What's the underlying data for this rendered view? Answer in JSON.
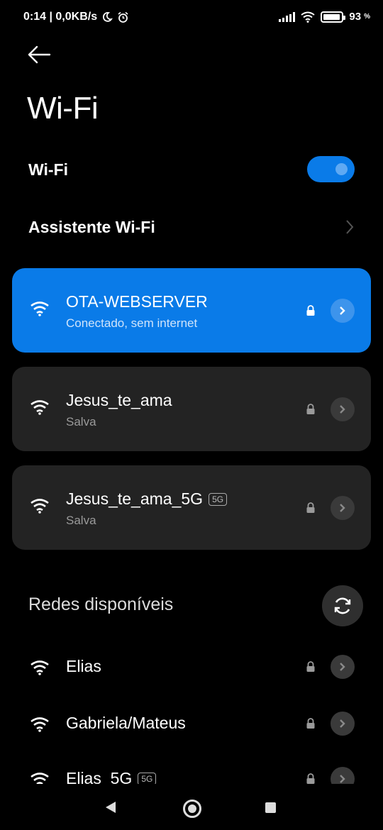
{
  "status_bar": {
    "left_text": "0:14 | 0,0KB/s",
    "battery": "93",
    "battery_unit": "%",
    "battery_level": 0.93
  },
  "page": {
    "title": "Wi-Fi"
  },
  "wifi_toggle": {
    "label": "Wi-Fi",
    "enabled": true
  },
  "assistant": {
    "label": "Assistente Wi-Fi"
  },
  "saved_networks": [
    {
      "name": "OTA-WEBSERVER",
      "status": "Conectado, sem internet",
      "secured": true,
      "connected": true
    },
    {
      "name": "Jesus_te_ama",
      "status": "Salva",
      "secured": true,
      "connected": false
    },
    {
      "name": "Jesus_te_ama_5G",
      "band_badge": "5G",
      "status": "Salva",
      "secured": true,
      "connected": false
    }
  ],
  "available": {
    "title": "Redes disponíveis",
    "networks": [
      {
        "name": "Elias",
        "secured": true
      },
      {
        "name": "Gabriela/Mateus",
        "secured": true
      },
      {
        "name": "Elias_5G",
        "band_badge": "5G",
        "secured": true
      }
    ]
  },
  "colors": {
    "accent": "#0a7be8",
    "card_bg": "#232323",
    "background": "#000000"
  }
}
